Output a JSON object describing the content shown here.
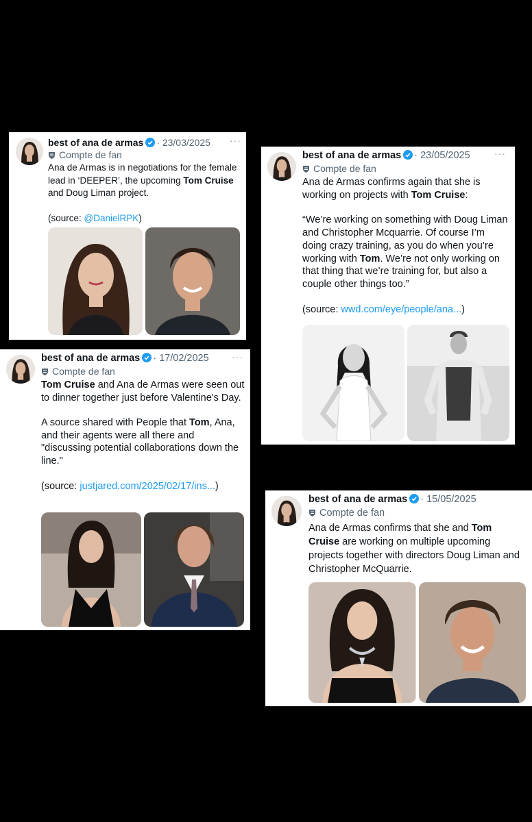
{
  "colors": {
    "background": "#000000",
    "card": "#ffffff",
    "link": "#1d9bf0",
    "verified": "#1d9bf0",
    "muted": "#536471"
  },
  "posts": [
    {
      "author": "best of ana de armas",
      "date": "· 23/03/2025",
      "label": "Compte de fan",
      "more": "···",
      "p1_pre": "Ana de Armas is in negotiations for the female lead in ‘DEEPER’, the upcoming ",
      "p1_bold": "Tom Cruise",
      "p1_post": " and Doug Liman project.",
      "source_pre": "(source: ",
      "source_link": "@DanielRPK",
      "source_post": ")",
      "photos": [
        "ana-portrait",
        "tom-portrait"
      ]
    },
    {
      "author": "best of ana de armas",
      "date": "· 23/05/2025",
      "label": "Compte de fan",
      "more": "···",
      "p1_pre": "Ana de Armas confirms again that she is working on projects with ",
      "p1_bold": "Tom Cruise",
      "p1_post": ":",
      "quote_pre": "“We’re working on something with Doug Liman and Christopher Mcquarrie. Of course I’m doing crazy training, as you do when you’re working with ",
      "quote_bold": "Tom",
      "quote_post": ". We’re not only working on that thing that we’re training for, but also a couple other things too.”",
      "source_pre": "(source: ",
      "source_link": "wwd.com/eye/people/ana...",
      "source_post": ")",
      "photos": [
        "ana-bw",
        "tom-bw"
      ]
    },
    {
      "author": "best of ana de armas",
      "date": "· 17/02/2025",
      "label": "Compte de fan",
      "more": "···",
      "p1_bold": "Tom Cruise",
      "p1_post": " and Ana de Armas were seen out to dinner together just before Valentine's Day.",
      "p2_pre": "A source shared with People that ",
      "p2_bold": "Tom",
      "p2_post": ", Ana, and their agents were all there and \"discussing potential collaborations down the line.\"",
      "source_pre": "(source: ",
      "source_link": "justjared.com/2025/02/17/ins...",
      "source_post": ")",
      "photos": [
        "ana-black-dress",
        "tom-suit"
      ]
    },
    {
      "author": "best of ana de armas",
      "date": "· 15/05/2025",
      "label": "Compte de fan",
      "more": "···",
      "p1_pre": "Ana de Armas confirms that she and ",
      "p1_bold": "Tom Cruise",
      "p1_post": " are working on multiple upcoming projects together with directors Doug Liman and Christopher McQuarrie.",
      "photos": [
        "ana-necklace",
        "tom-smile"
      ]
    }
  ]
}
